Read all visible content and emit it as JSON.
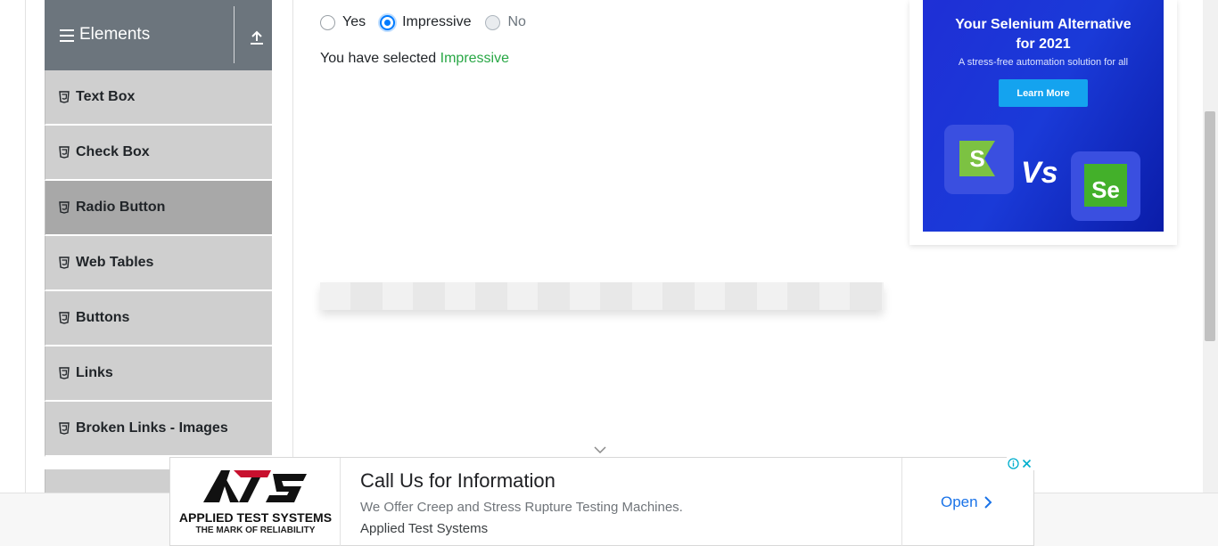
{
  "sidebar": {
    "group_title": "Elements",
    "items": [
      {
        "label": "Text Box",
        "active": false
      },
      {
        "label": "Check Box",
        "active": false
      },
      {
        "label": "Radio Button",
        "active": true
      },
      {
        "label": "Web Tables",
        "active": false
      },
      {
        "label": "Buttons",
        "active": false
      },
      {
        "label": "Links",
        "active": false
      },
      {
        "label": "Broken Links - Images",
        "active": false
      }
    ]
  },
  "radio_group": {
    "options": [
      {
        "label": "Yes",
        "checked": false,
        "disabled": false
      },
      {
        "label": "Impressive",
        "checked": true,
        "disabled": false
      },
      {
        "label": "No",
        "checked": false,
        "disabled": true
      }
    ],
    "result_prefix": "You have selected",
    "result_value": "Impressive"
  },
  "right_ad": {
    "headline_line1": "Your Selenium Alternative",
    "headline_line2": "for 2021",
    "subtext": "A stress-free automation solution for all",
    "cta": "Learn More",
    "left_logo_letter": "S",
    "vs_text": "Vs",
    "right_logo_text": "Se"
  },
  "bottom_ad": {
    "brand": "APPLIED TEST SYSTEMS",
    "brand_tagline": "THE MARK OF RELIABILITY",
    "logo_letters": "ATS",
    "title": "Call Us for Information",
    "description": "We Offer Creep and Stress Rupture Testing Machines.",
    "advertiser": "Applied Test Systems",
    "cta": "Open"
  },
  "colors": {
    "accent_green": "#28a745",
    "radio_blue": "#007bff",
    "sidebar_header": "#6c757d",
    "menu_item_bg": "#cfcfcf",
    "menu_item_active": "#a8a8a8",
    "ad_blue": "#1a3ad8",
    "link_blue": "#1a73e8"
  }
}
